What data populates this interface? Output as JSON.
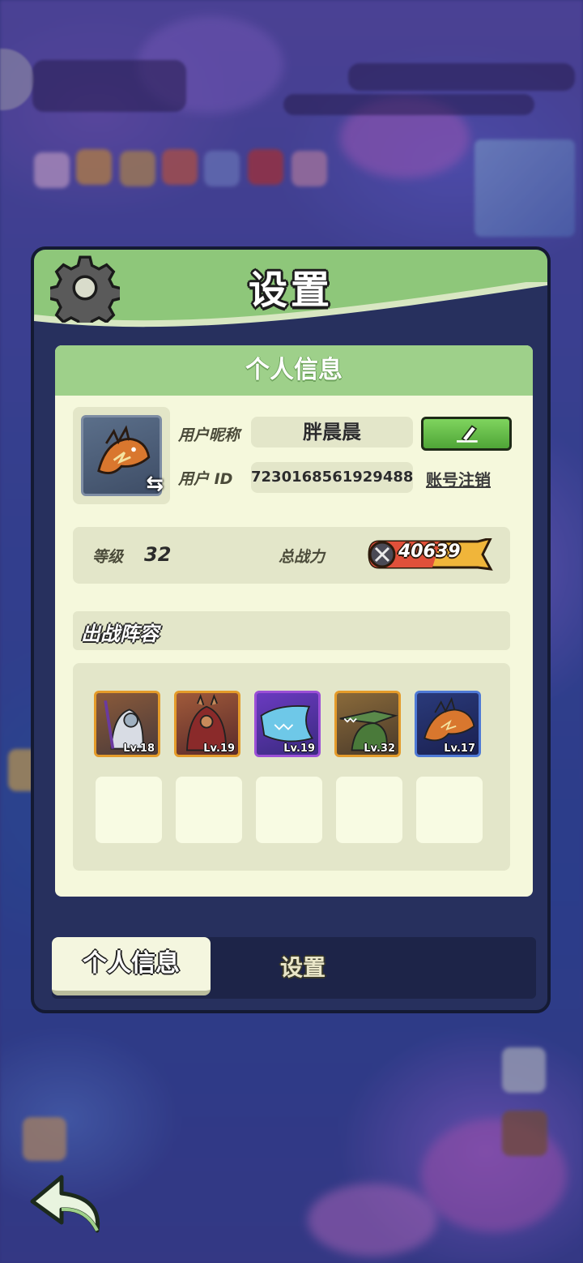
{
  "panel": {
    "title": "设置",
    "gear_icon": "gear-icon"
  },
  "profile": {
    "section_header": "个人信息",
    "nickname_label": "用户昵称",
    "nickname_value": "胖晨晨",
    "id_label": "用户 ID",
    "id_value": "7230168561929488",
    "cancel_account_label": "账号注销",
    "level_label": "等级",
    "level_value": "32",
    "power_label": "总战力",
    "power_value": "40639"
  },
  "lineup": {
    "title": "出战阵容",
    "heroes": [
      {
        "level": "Lv.18",
        "rarity_color": "#e49b2a"
      },
      {
        "level": "Lv.19",
        "rarity_color": "#e49b2a"
      },
      {
        "level": "Lv.19",
        "rarity_color": "#9b4fd6"
      },
      {
        "level": "Lv.32",
        "rarity_color": "#e49b2a"
      },
      {
        "level": "Lv.17",
        "rarity_color": "#4f7ad6"
      }
    ],
    "empty_slots": 5
  },
  "tabs": {
    "profile": "个人信息",
    "settings": "设置"
  },
  "colors": {
    "header_green": "#8ec77a",
    "card_bg": "#f5f8dc",
    "edit_button": "#5fb545",
    "panel_dark": "#27305e"
  }
}
